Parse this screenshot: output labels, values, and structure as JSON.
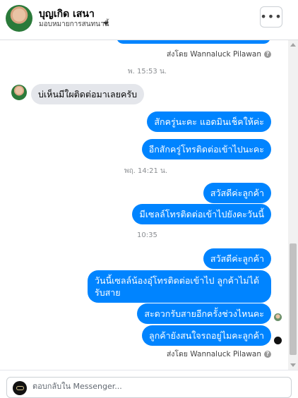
{
  "header": {
    "name": "บุญเกิด เสนา",
    "assign_label": "มอบหมายการสนทนานี้",
    "more_label": "•••"
  },
  "messages": {
    "sent_by_1": "ส่งโดย Wannaluck Pilawan",
    "ts_1": "พ. 15:53 น.",
    "in_1": "บ่เห็นมีใผติดต่อมาเลยครับ",
    "out_1": "สักครู่นะคะ แอดมินเช็คให้ค่ะ",
    "out_2": "อีกสักครู่โทรติดต่อเข้าไปนะคะ",
    "ts_2": "พฤ. 14:21 น.",
    "out_3": "สวัสดีค่ะลูกค้า",
    "out_4": "มีเซลล์โทรติดต่อเข้าไปยังคะวันนี้",
    "ts_3": "10:35",
    "out_5": "สวัสดีค่ะลูกค้า",
    "out_6": "วันนี้เซลล์น้องอุ๋โทรติดต่อเข้าไป ลูกค้าไม่ได้รับสาย",
    "out_7": "สะดวกรับสายอีกครั้งช่วงไหนคะ",
    "out_8": "ลูกค้ายังสนใจรถอยู่ไมคะลูกค้า",
    "sent_by_2": "ส่งโดย Wannaluck Pilawan",
    "info_glyph": "?"
  },
  "composer": {
    "placeholder": "ตอบกลับใน Messenger..."
  },
  "colors": {
    "outgoing_bubble": "#0084ff",
    "incoming_bubble": "#e4e6eb"
  }
}
